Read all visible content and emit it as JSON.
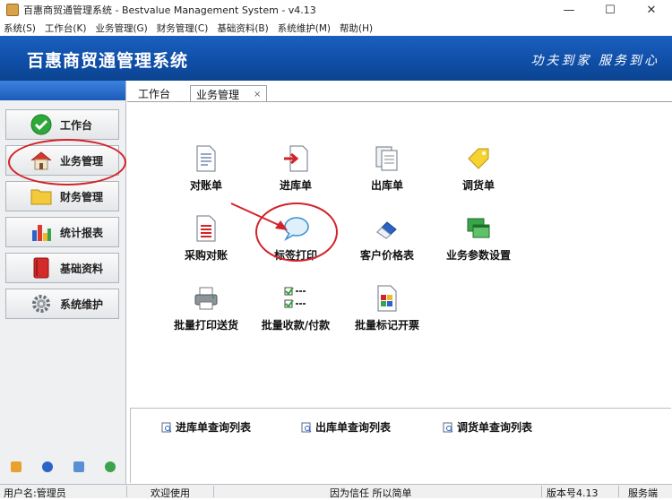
{
  "window": {
    "title": "百惠商贸通管理系统 - Bestvalue Management System - v4.13",
    "min_glyph": "—",
    "max_glyph": "☐",
    "close_glyph": "✕"
  },
  "menu": [
    "系统(S)",
    "工作台(K)",
    "业务管理(G)",
    "财务管理(C)",
    "基础资料(B)",
    "系统维护(M)",
    "帮助(H)"
  ],
  "banner": {
    "app_title": "百惠商贸通管理系统",
    "slogan": "功夫到家  服务到心"
  },
  "sidebar": {
    "items": [
      {
        "label": "工作台",
        "icon": "check-icon"
      },
      {
        "label": "业务管理",
        "icon": "house-icon"
      },
      {
        "label": "财务管理",
        "icon": "folder-icon"
      },
      {
        "label": "统计报表",
        "icon": "bar-chart-icon"
      },
      {
        "label": "基础资料",
        "icon": "book-icon"
      },
      {
        "label": "系统维护",
        "icon": "gear-icon"
      }
    ]
  },
  "tabs": [
    {
      "label": "工作台"
    },
    {
      "label": "业务管理",
      "close": "×"
    }
  ],
  "functions": [
    {
      "label": "对账单",
      "icon": "document-icon"
    },
    {
      "label": "进库单",
      "icon": "inbound-icon"
    },
    {
      "label": "出库单",
      "icon": "copy-document-icon"
    },
    {
      "label": "调货单",
      "icon": "tag-icon"
    },
    {
      "label": "采购对账",
      "icon": "red-list-icon"
    },
    {
      "label": "标签打印",
      "icon": "speech-bubble-icon"
    },
    {
      "label": "客户价格表",
      "icon": "eraser-icon"
    },
    {
      "label": "业务参数设置",
      "icon": "windows-icon"
    },
    {
      "label": "批量打印送货",
      "icon": "printer-icon"
    },
    {
      "label": "批量收款/付款",
      "icon": "checklist-icon"
    },
    {
      "label": "批量标记开票",
      "icon": "color-grid-icon"
    }
  ],
  "quick_lists": [
    {
      "label": "进库单查询列表",
      "icon": "search-list-icon"
    },
    {
      "label": "出库单查询列表",
      "icon": "search-list-icon"
    },
    {
      "label": "调货单查询列表",
      "icon": "search-list-icon"
    }
  ],
  "status": {
    "user": "用户名:管理员",
    "welcome": "欢迎使用",
    "motto": "因为信任 所以简单",
    "version": "版本号4.13",
    "mode": "服务端"
  },
  "colors": {
    "banner": "#1257b8",
    "highlight_ring": "#d2232a"
  }
}
